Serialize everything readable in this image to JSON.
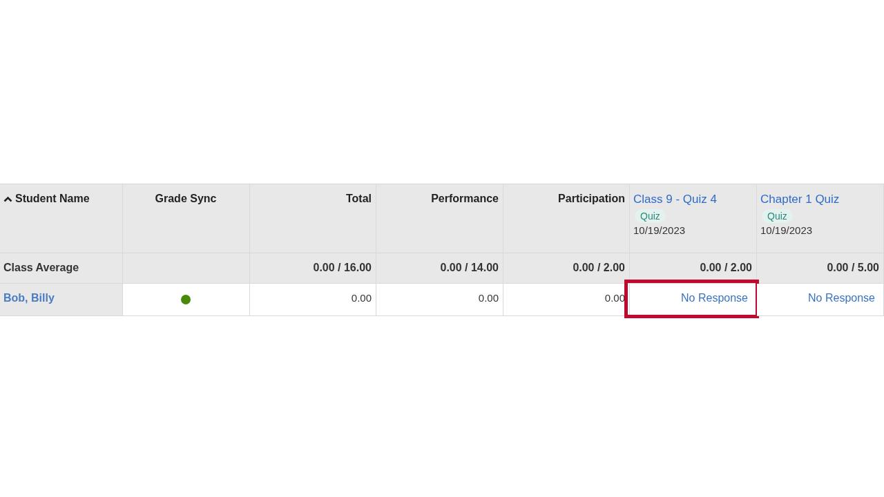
{
  "columns": [
    {
      "kind": "sortable",
      "label": "Student Name",
      "sorted_ascending": true
    },
    {
      "kind": "center",
      "label": "Grade Sync"
    },
    {
      "kind": "right",
      "label": "Total"
    },
    {
      "kind": "right",
      "label": "Performance"
    },
    {
      "kind": "right",
      "label": "Participation"
    },
    {
      "kind": "item",
      "label": "Class 9 - Quiz 4",
      "tag": "Quiz",
      "date": "10/19/2023"
    },
    {
      "kind": "item",
      "label": "Chapter 1 Quiz",
      "tag": "Quiz",
      "date": "10/19/2023"
    }
  ],
  "class_average": {
    "label": "Class Average",
    "values": [
      "0.00 / 16.00",
      "0.00 / 14.00",
      "0.00 / 2.00",
      "0.00 / 2.00",
      "0.00 / 5.00"
    ]
  },
  "students": [
    {
      "name": "Bob, Billy",
      "synced": true,
      "scores": [
        "0.00",
        "0.00",
        "0.00"
      ],
      "items": [
        {
          "text": "No Response",
          "highlighted": true
        },
        {
          "text": "No Response",
          "highlighted": false
        }
      ]
    }
  ]
}
